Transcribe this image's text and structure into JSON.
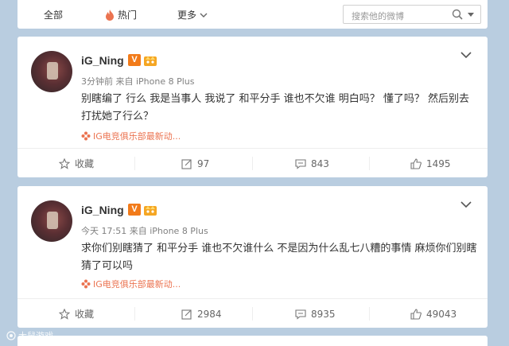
{
  "nav": {
    "tabs": [
      {
        "label": "全部"
      },
      {
        "label": "热门",
        "icon": "fire-icon"
      },
      {
        "label": "更多",
        "icon": "chevron-down-icon"
      }
    ],
    "search_placeholder": "搜索他的微博"
  },
  "posts": [
    {
      "username": "iG_Ning",
      "verified": "V",
      "meta": "3分钟前 来自 iPhone 8 Plus",
      "text": "别瞎编了 行么 我是当事人 我说了 和平分手 谁也不欠谁 明白吗？ 懂了吗？ 然后别去打扰她了行么？",
      "source": "IG电竞俱乐部最新动...",
      "actions": {
        "favorite": "收藏",
        "forwards": "97",
        "comments": "843",
        "likes": "1495"
      }
    },
    {
      "username": "iG_Ning",
      "verified": "V",
      "meta": "今天 17:51 来自 iPhone 8 Plus",
      "text": "求你们别瞎猜了 和平分手 谁也不欠谁什么 不是因为什么乱七八糟的事情 麻烦你们别瞎猜了可以吗",
      "source": "IG电竞俱乐部最新动...",
      "actions": {
        "favorite": "收藏",
        "forwards": "2984",
        "comments": "8935",
        "likes": "49043"
      }
    }
  ],
  "watermark": "大鼠游戏",
  "colors": {
    "accent": "#eb7350",
    "badge": "#f27b1a",
    "page_bg": "#b9cde0"
  }
}
